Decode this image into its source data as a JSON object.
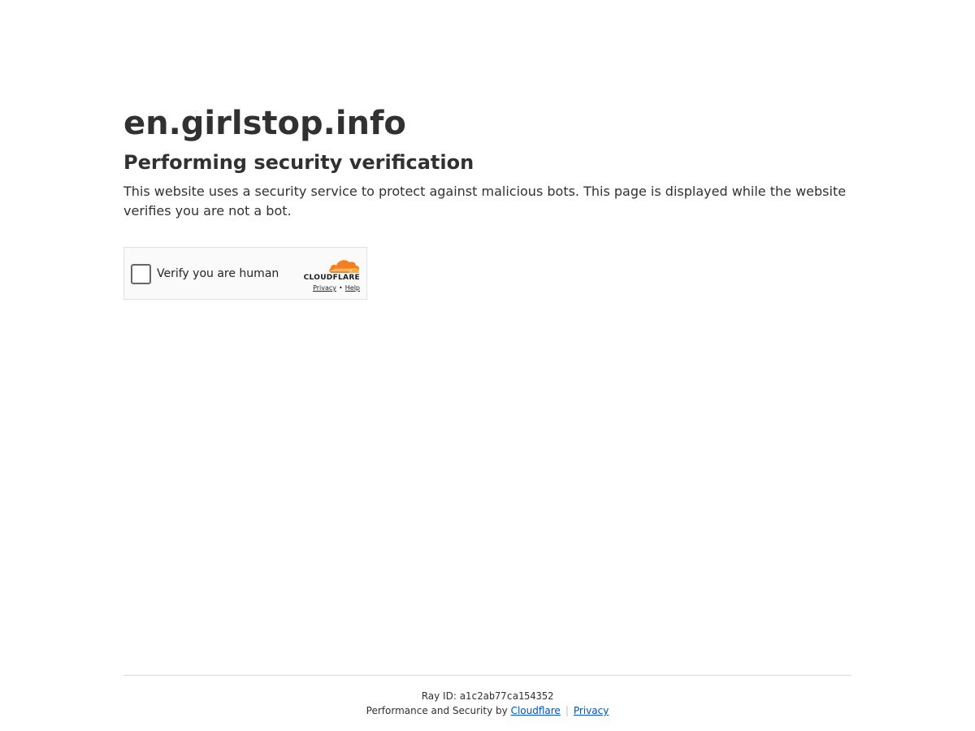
{
  "page": {
    "site_name": "en.girlstop.info",
    "headline": "Performing security verification",
    "description": "This website uses a security service to protect against malicious bots. This page is displayed while the website verifies you are not a bot."
  },
  "widget": {
    "checkbox_label": "Verify you are human",
    "checked": false,
    "brand": "CLOUDFLARE",
    "privacy_link": "Privacy",
    "separator": "•",
    "help_link": "Help",
    "logo_icon": "cloudflare-cloud-logo",
    "brand_color": "#f38020"
  },
  "footer": {
    "ray_label": "Ray ID:",
    "ray_id": "a1c2ab77ca154352",
    "performance_text": "Performance and Security by",
    "cloudflare_link": "Cloudflare",
    "separator": "|",
    "privacy_link": "Privacy",
    "link_color": "#0051c3"
  }
}
